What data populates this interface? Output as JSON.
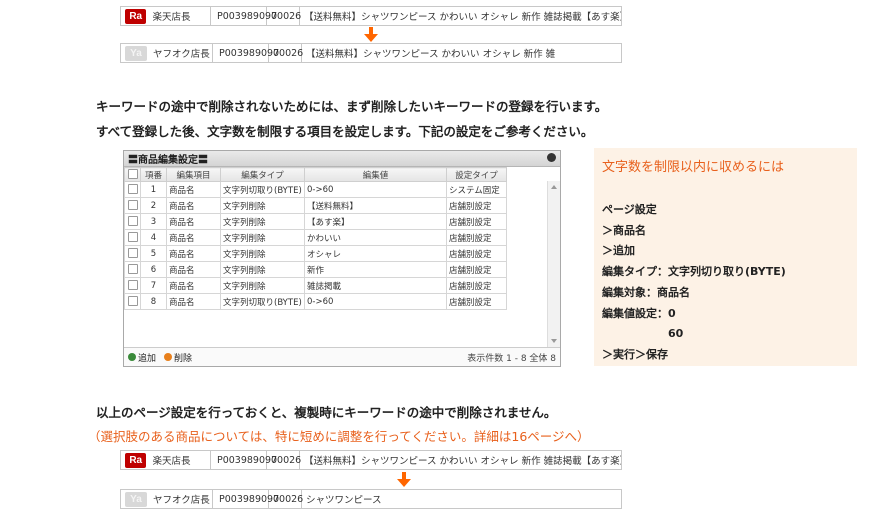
{
  "rows": {
    "r1": {
      "badge": "Ra",
      "store": "楽天店長",
      "code": "P003989097",
      "num": "00026",
      "title": "【送料無料】シャツワンピース かわいい オシャレ 新作 雑誌掲載【あす楽】"
    },
    "r2": {
      "badge": "Ya",
      "store": "ヤフオク店長",
      "code": "P003989097",
      "num": "00026",
      "title": "【送料無料】シャツワンピース かわいい オシャレ 新作 雑"
    },
    "r3": {
      "badge": "Ra",
      "store": "楽天店長",
      "code": "P003989097",
      "num": "00026",
      "title": "【送料無料】シャツワンピース かわいい オシャレ 新作 雑誌掲載【あす楽】"
    },
    "r4": {
      "badge": "Ya",
      "store": "ヤフオク店長",
      "code": "P003989097",
      "num": "00026",
      "title": "シャツワンピース"
    }
  },
  "text": {
    "p1": "キーワードの途中で削除されないためには、まず削除したいキーワードの登録を行います。",
    "p2": "すべて登録した後、文字数を制限する項目を設定します。下記の設定をご参考ください。",
    "p3": "以上のページ設定を行っておくと、複製時にキーワードの途中で削除されません。",
    "p4": "（選択肢のある商品については、特に短めに調整を行ってください。詳細は16ページへ）"
  },
  "panel": {
    "title": "〓商品編集設定〓",
    "headers": [
      "項番",
      "編集項目",
      "編集タイプ",
      "編集値",
      "設定タイプ"
    ],
    "rows": [
      [
        "1",
        "商品名",
        "文字列切取り(BYTE)",
        "0->60",
        "システム固定"
      ],
      [
        "2",
        "商品名",
        "文字列削除",
        "【送料無料】",
        "店舗別設定"
      ],
      [
        "3",
        "商品名",
        "文字列削除",
        "【あす楽】",
        "店舗別設定"
      ],
      [
        "4",
        "商品名",
        "文字列削除",
        "かわいい",
        "店舗別設定"
      ],
      [
        "5",
        "商品名",
        "文字列削除",
        "オシャレ",
        "店舗別設定"
      ],
      [
        "6",
        "商品名",
        "文字列削除",
        "新作",
        "店舗別設定"
      ],
      [
        "7",
        "商品名",
        "文字列削除",
        "雑誌掲載",
        "店舗別設定"
      ],
      [
        "8",
        "商品名",
        "文字列切取り(BYTE)",
        "0->60",
        "店舗別設定"
      ]
    ],
    "add": "追加",
    "del": "削除",
    "paging": "表示件数 1 - 8 全体 8"
  },
  "info": {
    "title": "文字数を制限以内に収めるには",
    "lines": [
      "ページ設定",
      "＞商品名",
      "＞追加",
      "編集タイプ：文字列切り取り(BYTE)",
      "編集対象：商品名",
      "編集値設定：0",
      "60",
      "＞実行＞保存"
    ]
  },
  "colors": {
    "accent": "#e8601c",
    "rakuten": "#bf0000",
    "arrow": "#ff6600",
    "infobg": "#fdf2e6"
  }
}
